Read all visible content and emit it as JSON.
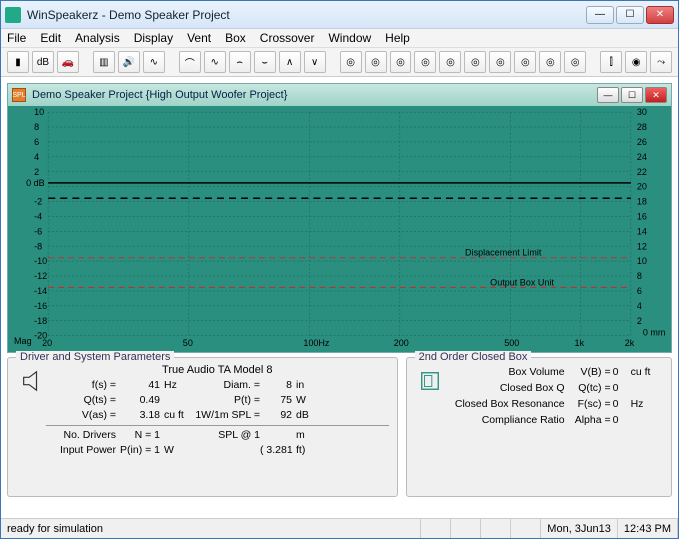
{
  "app": {
    "title": "WinSpeakerz - Demo Speaker Project"
  },
  "menu": [
    "File",
    "Edit",
    "Analysis",
    "Display",
    "Vent",
    "Box",
    "Crossover",
    "Window",
    "Help"
  ],
  "child": {
    "title": "Demo Speaker Project {High Output Woofer Project}",
    "icon_label": "SPL"
  },
  "chart_data": {
    "type": "line",
    "title": "",
    "xlabel": "Mag",
    "x_ticks": [
      "20",
      "50",
      "100Hz",
      "200",
      "500",
      "1k",
      "2k"
    ],
    "y_left_label": "dB",
    "y_left_ticks": [
      10,
      8,
      6,
      4,
      2,
      0,
      -2,
      -4,
      -6,
      -8,
      -10,
      -12,
      -14,
      -16,
      -18,
      -20
    ],
    "y_right_label": "mm",
    "y_right_ticks": [
      30,
      28,
      26,
      24,
      22,
      20,
      18,
      16,
      14,
      12,
      10,
      8,
      6,
      4,
      2,
      0
    ],
    "xlim": [
      20,
      2000
    ],
    "ylim_left": [
      -20,
      10
    ],
    "ylim_right": [
      0,
      30
    ],
    "series": [
      {
        "name": "response",
        "color": "#000",
        "dash": "solid",
        "y_at_all_x": 0
      },
      {
        "name": "alt-line",
        "color": "#000",
        "dash": "dashed",
        "y_at_all_x": -2.2
      },
      {
        "name": "displacement-limit",
        "color": "#c03030",
        "dash": "dashed",
        "y_right_at_all_x": 10,
        "label": "Displacement Limit"
      },
      {
        "name": "output-box-unit",
        "color": "#c03030",
        "dash": "dashed",
        "y_right_at_all_x": 6,
        "label": "Output Box Unit"
      }
    ]
  },
  "driver_panel": {
    "title": "Driver and System Parameters",
    "model": "True Audio TA Model 8",
    "rows": [
      {
        "l1": "f(s) =",
        "v1": "41",
        "u1": "Hz",
        "l2": "Diam. =",
        "v2": "8",
        "u2": "in"
      },
      {
        "l1": "Q(ts) =",
        "v1": "0.49",
        "u1": "",
        "l2": "P(t) =",
        "v2": "75",
        "u2": "W"
      },
      {
        "l1": "V(as) =",
        "v1": "3.18",
        "u1": "cu ft",
        "l2": "1W/1m SPL =",
        "v2": "92",
        "u2": "dB"
      }
    ],
    "rows2": [
      {
        "l1": "No. Drivers",
        "v1": "N = 1",
        "u1": "",
        "l2": "SPL @ 1",
        "v2": "",
        "u2": "m"
      },
      {
        "l1": "Input Power",
        "v1": "P(in) = 1",
        "u1": "W",
        "l2": "",
        "v2": "( 3.281",
        "u2": "ft)"
      }
    ]
  },
  "box_panel": {
    "title": "2nd Order Closed Box",
    "rows": [
      {
        "l": "Box Volume",
        "p": "V(B) =",
        "v": "0",
        "u": "cu ft"
      },
      {
        "l": "Closed Box Q",
        "p": "Q(tc) =",
        "v": "0",
        "u": ""
      },
      {
        "l": "Closed Box Resonance",
        "p": "F(sc) =",
        "v": "0",
        "u": "Hz"
      },
      {
        "l": "Compliance Ratio",
        "p": "Alpha =",
        "v": "0",
        "u": ""
      }
    ]
  },
  "status": {
    "text": "ready for simulation",
    "date": "Mon, 3Jun13",
    "time": "12:43  PM"
  }
}
